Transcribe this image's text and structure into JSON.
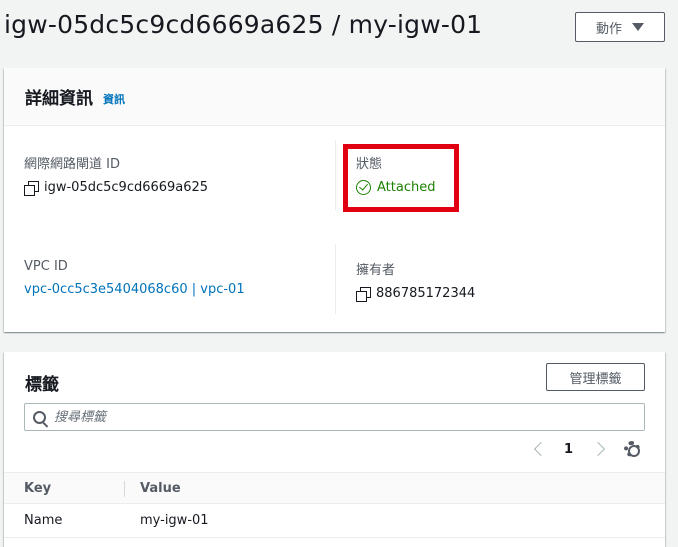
{
  "header": {
    "title": "igw-05dc5c9cd6669a625 / my-igw-01",
    "actions_label": "動作"
  },
  "details": {
    "title": "詳細資訊",
    "info_link": "資訊",
    "fields": {
      "igw_id_label": "網際網路閘道 ID",
      "igw_id_value": "igw-05dc5c9cd6669a625",
      "state_label": "狀態",
      "state_value": "Attached",
      "vpc_label": "VPC ID",
      "vpc_value": "vpc-0cc5c3e5404068c60 | vpc-01",
      "owner_label": "擁有者",
      "owner_value": "886785172344"
    }
  },
  "tags": {
    "title": "標籤",
    "manage_label": "管理標籤",
    "search_placeholder": "搜尋標籤",
    "page": "1",
    "columns": [
      "Key",
      "Value"
    ],
    "rows": [
      {
        "key": "Name",
        "value": "my-igw-01"
      }
    ]
  },
  "colors": {
    "link": "#0073bb",
    "status_ok": "#1d8102",
    "highlight": "#e00012"
  }
}
